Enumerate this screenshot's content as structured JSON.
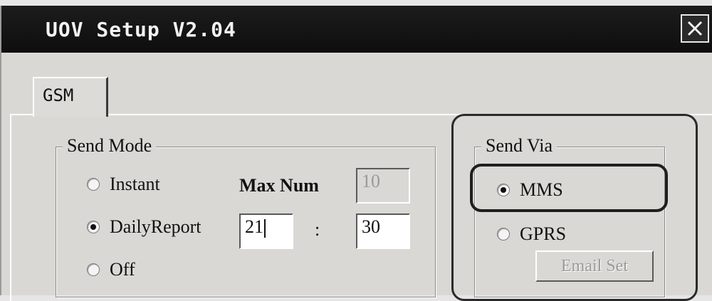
{
  "window": {
    "title": "UOV Setup V2.04",
    "close_icon": "close-icon"
  },
  "tabs": [
    {
      "label": "GSM",
      "active": true
    }
  ],
  "send_mode": {
    "title": "Send Mode",
    "options": [
      {
        "label": "Instant",
        "checked": false
      },
      {
        "label": "DailyReport",
        "checked": true
      },
      {
        "label": "Off",
        "checked": false
      }
    ],
    "max_num_label": "Max Num",
    "max_num_value": "10",
    "hour_value": "21",
    "time_separator": ":",
    "minute_value": "30"
  },
  "send_via": {
    "title": "Send Via",
    "options": [
      {
        "label": "MMS",
        "checked": true
      },
      {
        "label": "GPRS",
        "checked": false
      }
    ],
    "email_set_label": "Email Set"
  }
}
